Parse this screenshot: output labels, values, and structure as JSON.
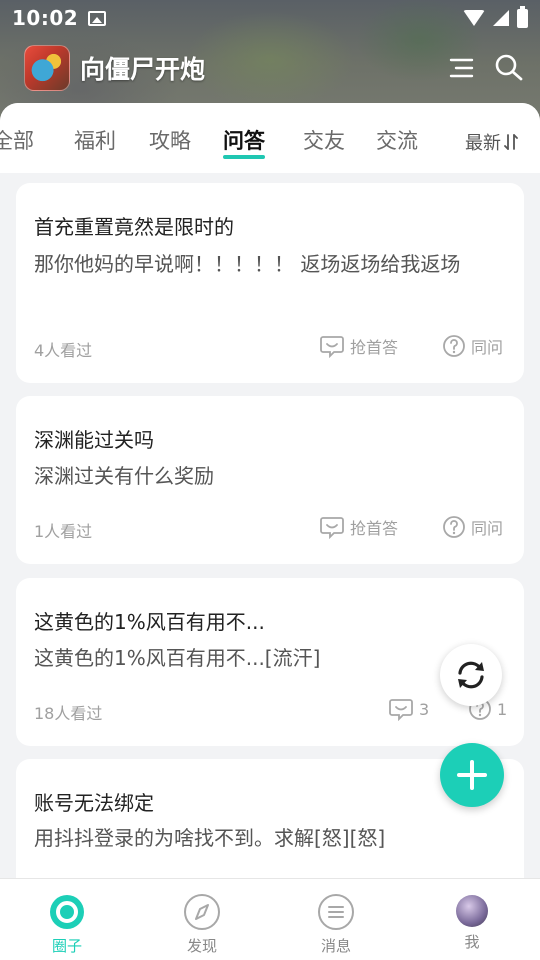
{
  "status": {
    "time": "10:02"
  },
  "header": {
    "app_title": "向僵尸开炮"
  },
  "tabs": {
    "items": [
      "全部",
      "福利",
      "攻略",
      "问答",
      "交友",
      "交流"
    ],
    "active": "问答",
    "sort_label": "最新"
  },
  "posts": [
    {
      "title": "首充重置竟然是限时的",
      "body": "那你他妈的早说啊！！！！！ 返场返场给我返场",
      "views": "4人看过",
      "answer_label": "抢首答",
      "same_label": "同问"
    },
    {
      "title": "深渊能过关吗",
      "body": "深渊过关有什么奖励",
      "views": "1人看过",
      "answer_label": "抢首答",
      "same_label": "同问"
    },
    {
      "title": "这黄色的1%风百有用不...",
      "body": "这黄色的1%风百有用不...[流汗]",
      "views": "18人看过",
      "answer_label": "3",
      "same_label": "1"
    },
    {
      "title": "账号无法绑定",
      "body": "用抖抖登录的为啥找不到。求解[怒][怒]"
    }
  ],
  "bottom_nav": [
    {
      "label": "圈子",
      "icon": "circle-icon",
      "active": true
    },
    {
      "label": "发现",
      "icon": "compass-icon",
      "active": false
    },
    {
      "label": "消息",
      "icon": "message-icon",
      "active": false
    },
    {
      "label": "我",
      "icon": "avatar",
      "active": false
    }
  ],
  "colors": {
    "accent": "#1ccfb7",
    "tab_underline": "#20c7b2"
  }
}
